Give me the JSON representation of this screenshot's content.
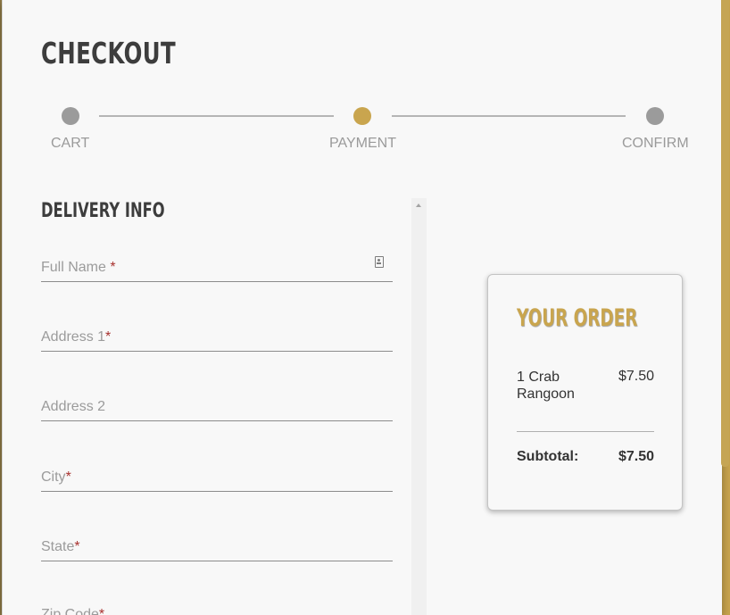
{
  "page": {
    "title": "CHECKOUT"
  },
  "colors": {
    "accent": "#c9a54e",
    "inactive_step": "#9b9b9b",
    "required": "#a8322f",
    "text_dark": "#3d3d3d"
  },
  "stepper": {
    "steps": [
      {
        "label": "CART",
        "active": false
      },
      {
        "label": "PAYMENT",
        "active": true
      },
      {
        "label": "CONFIRM",
        "active": false
      }
    ]
  },
  "delivery": {
    "title": "DELIVERY INFO",
    "fields": [
      {
        "label": "Full Name ",
        "required": true,
        "icon": "contact-card-icon"
      },
      {
        "label": "Address 1",
        "required": true
      },
      {
        "label": "Address 2",
        "required": false
      },
      {
        "label": "City",
        "required": true
      },
      {
        "label": "State",
        "required": true
      },
      {
        "label": "Zip Code",
        "required": true
      }
    ],
    "required_marker": "*"
  },
  "order": {
    "title": "YOUR ORDER",
    "items": [
      {
        "name": "1 Crab Rangoon",
        "price": "$7.50"
      }
    ],
    "subtotal_label": "Subtotal:",
    "subtotal_value": "$7.50"
  }
}
